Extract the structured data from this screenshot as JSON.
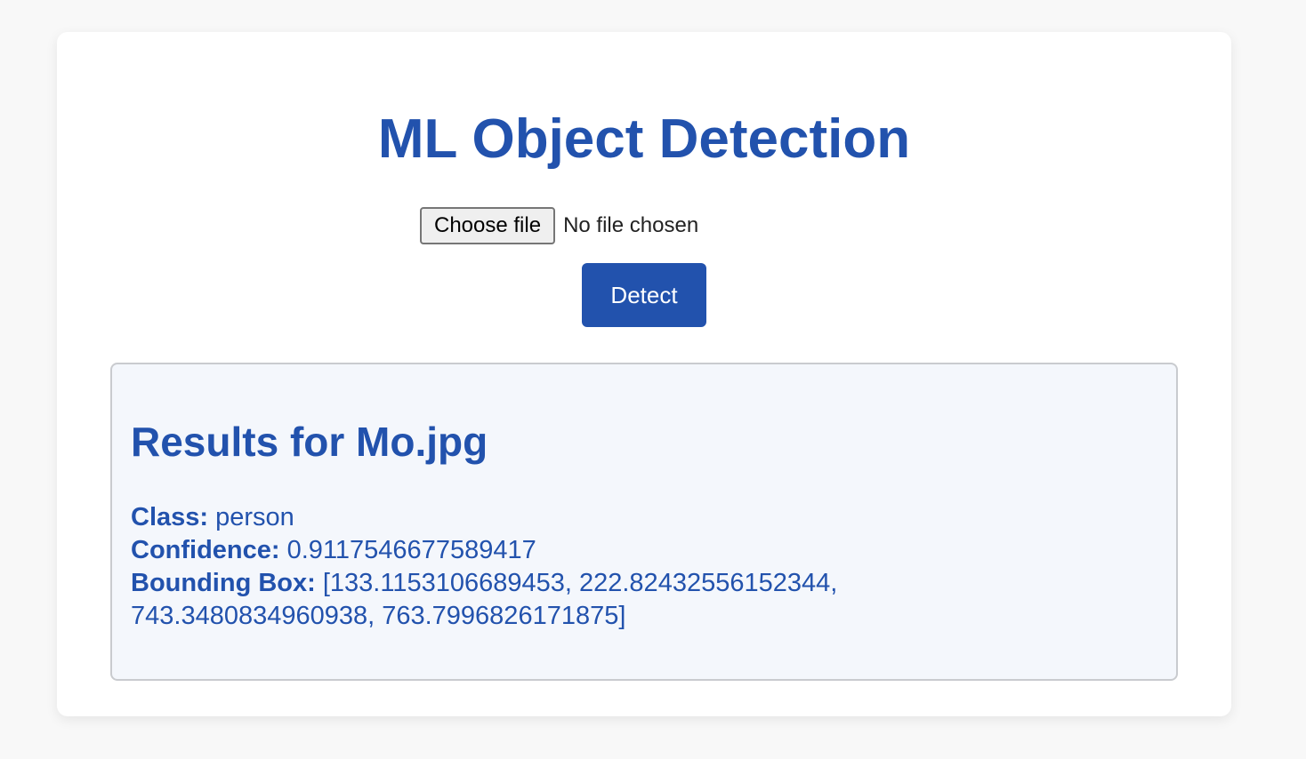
{
  "header": {
    "title": "ML Object Detection"
  },
  "upload": {
    "choose_label": "Choose file",
    "status": "No file chosen",
    "detect_label": "Detect"
  },
  "results": {
    "title": "Results for Mo.jpg",
    "class_label": "Class:",
    "class_value": "person",
    "confidence_label": "Confidence:",
    "confidence_value": "0.9117546677589417",
    "bbox_label": "Bounding Box:",
    "bbox_value": "[133.1153106689453, 222.82432556152344, 743.3480834960938, 763.7996826171875]"
  },
  "colors": {
    "accent": "#2252ad",
    "results_background": "#f4f7fc"
  }
}
